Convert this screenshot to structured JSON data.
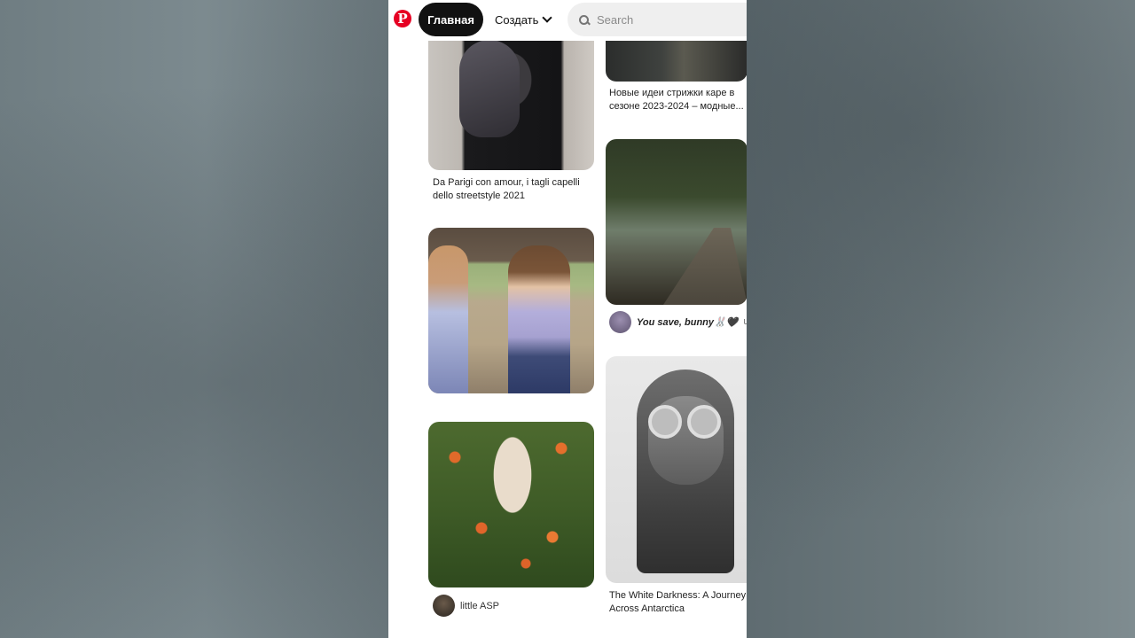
{
  "header": {
    "logo_letter": "P",
    "home_label": "Главная",
    "create_label": "Создать",
    "search_placeholder": "Search"
  },
  "pins": [
    {
      "title": "Da Parigi con amour, i tagli capelli dello streetstyle 2021"
    },
    {
      "title": "Новые идеи стрижки каре в сезоне 2023-2024 – модные..."
    },
    {
      "user": "You save, bunny🐰🖤",
      "user_suffix": "UA"
    },
    {
      "user": "little ASP"
    },
    {
      "title": "The White Darkness: A Journey Across Antarctica"
    }
  ],
  "colors": {
    "accent": "#e60023",
    "home_bg": "#111111",
    "search_bg": "#efefef"
  }
}
